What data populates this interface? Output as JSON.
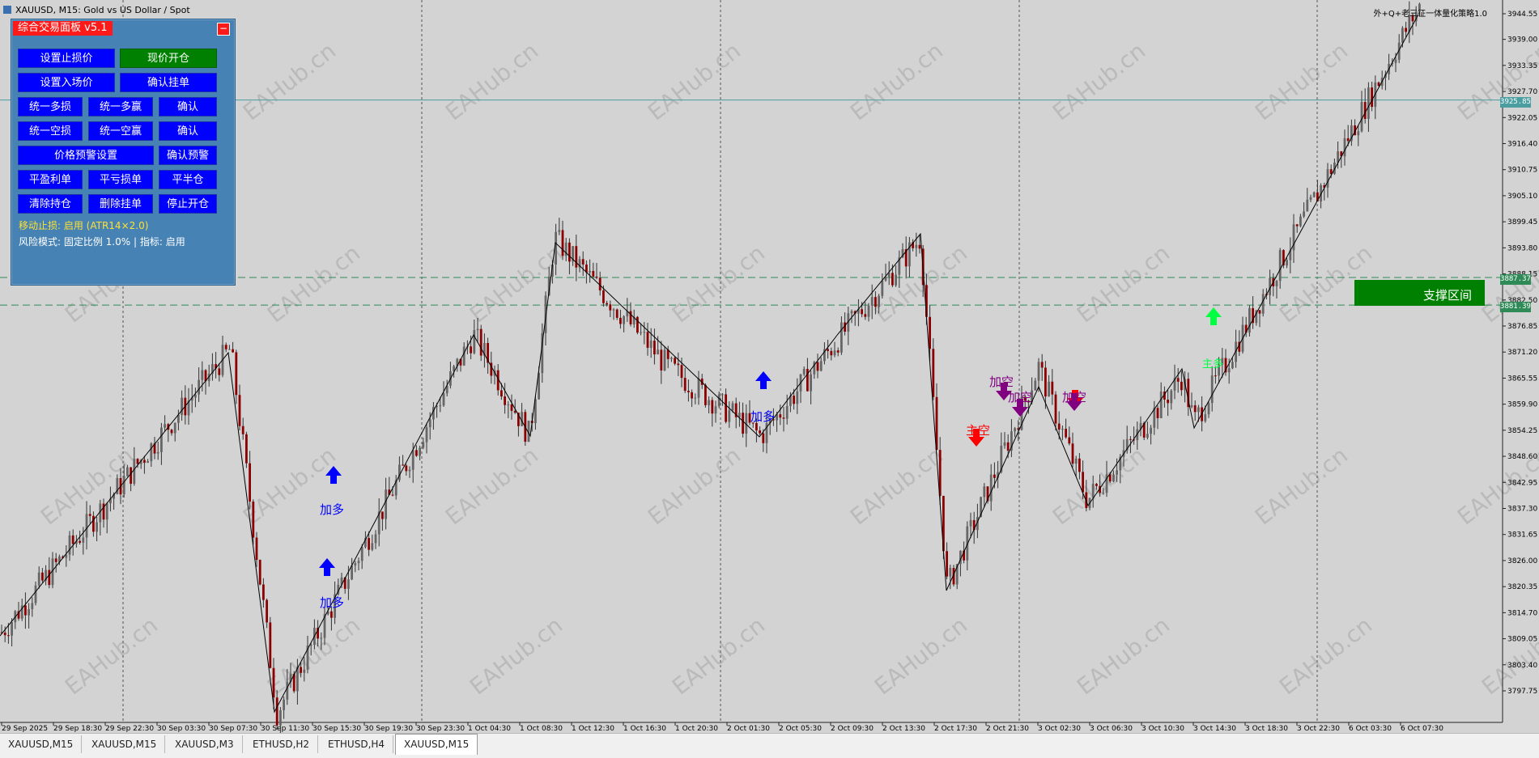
{
  "chart_header": {
    "title": "XAUUSD, M15:  Gold vs US Dollar / Spot",
    "ea_name": "外+Q+老三征一体量化策略1.0"
  },
  "price_axis": {
    "ticks": [
      "3944.55",
      "3939.00",
      "3933.35",
      "3927.70",
      "3922.05",
      "3916.40",
      "3910.75",
      "3905.10",
      "3899.45",
      "3893.80",
      "3888.15",
      "3882.50",
      "3876.85",
      "3871.20",
      "3865.55",
      "3859.90",
      "3854.25",
      "3848.60",
      "3842.95",
      "3837.30",
      "3831.65",
      "3826.00",
      "3820.35",
      "3814.70",
      "3809.05",
      "3803.40",
      "3797.75"
    ],
    "current_price_tag": "3925.85",
    "support_upper_tag": "3887.37",
    "support_lower_tag": "3881.39",
    "current_price_color": "#4a9ea0",
    "support_line_color": "#2e8b57"
  },
  "time_axis": {
    "labels": [
      "29 Sep 2025",
      "29 Sep 18:30",
      "29 Sep 22:30",
      "30 Sep 03:30",
      "30 Sep 07:30",
      "30 Sep 11:30",
      "30 Sep 15:30",
      "30 Sep 19:30",
      "30 Sep 23:30",
      "1 Oct 04:30",
      "1 Oct 08:30",
      "1 Oct 12:30",
      "1 Oct 16:30",
      "1 Oct 20:30",
      "2 Oct 01:30",
      "2 Oct 05:30",
      "2 Oct 09:30",
      "2 Oct 13:30",
      "2 Oct 17:30",
      "2 Oct 21:30",
      "3 Oct 02:30",
      "3 Oct 06:30",
      "3 Oct 10:30",
      "3 Oct 14:30",
      "3 Oct 18:30",
      "3 Oct 22:30",
      "6 Oct 03:30",
      "6 Oct 07:30"
    ]
  },
  "watermark": "EAHub.cn",
  "panel": {
    "title": "综合交易面板 v5.1",
    "close_symbol": "−",
    "buttons": {
      "set_stop_loss": "设置止损价",
      "market_open": "现价开仓",
      "set_entry": "设置入场价",
      "confirm_pending": "确认挂单",
      "unify_long_sl": "统一多损",
      "unify_long_tp": "统一多赢",
      "confirm_long": "确认",
      "unify_short_sl": "统一空损",
      "unify_short_tp": "统一空赢",
      "confirm_short": "确认",
      "price_alert": "价格预警设置",
      "confirm_alert": "确认预警",
      "close_profit": "平盈利单",
      "close_loss": "平亏损单",
      "close_half": "平半仓",
      "clear_positions": "清除持仓",
      "delete_pending": "删除挂单",
      "stop_open": "停止开仓"
    },
    "trailing_status": "移动止损: 启用 (ATR14×2.0)",
    "risk_status": "风险模式: 固定比例 1.0% | 指标: 启用"
  },
  "signals": {
    "add_long": "加多",
    "add_short": "加空",
    "main_short": "主空",
    "main_long": "主多",
    "long_color": "#0000ff",
    "short_color": "#800080",
    "main_short_color": "#ff0000",
    "main_long_color": "#00ff40"
  },
  "support_zone": {
    "label": "支撑区间",
    "color": "#008000"
  },
  "tabs": [
    "XAUUSD,M15",
    "XAUUSD,M15",
    "XAUUSD,M3",
    "ETHUSD,H2",
    "ETHUSD,H4",
    "XAUUSD,M15"
  ],
  "active_tab": 5,
  "colors": {
    "chart_bg": "#d3d3d3",
    "panel_bg": "#4682b4",
    "button_blue": "#0000ff",
    "button_green": "#008000"
  }
}
